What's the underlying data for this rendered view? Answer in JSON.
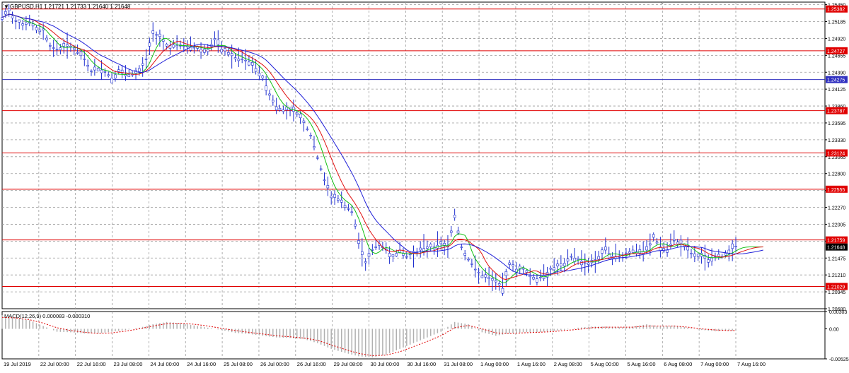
{
  "header": {
    "symbol_label": "GBPUSD,H1",
    "ohlc_label": "1.21721 1.21733 1.21640 1.21648"
  },
  "colors": {
    "candles": "#1f2fcf",
    "ma_fast": "#12c012",
    "ma_mid": "#e01010",
    "ma_slow": "#2020d8",
    "level_red": "#e00000",
    "level_blue": "#3030c0",
    "grid": "#9a9a9a",
    "macd_hist": "#b0b0b0",
    "macd_signal": "#e00000",
    "current_price_bg": "#000000"
  },
  "chart_data": [
    {
      "type": "line",
      "title": "",
      "xlabel": "",
      "ylabel": "",
      "ylim": [
        1.2068,
        1.2549
      ],
      "grid": true,
      "x_tick_labels": [
        "19 Jul 2019",
        "22 Jul 00:00",
        "22 Jul 16:00",
        "23 Jul 08:00",
        "24 Jul 00:00",
        "24 Jul 16:00",
        "25 Jul 08:00",
        "26 Jul 00:00",
        "26 Jul 16:00",
        "29 Jul 08:00",
        "30 Jul 00:00",
        "30 Jul 16:00",
        "31 Jul 08:00",
        "1 Aug 00:00",
        "1 Aug 16:00",
        "2 Aug 08:00",
        "5 Aug 00:00",
        "5 Aug 16:00",
        "6 Aug 08:00",
        "7 Aug 00:00",
        "7 Aug 16:00"
      ],
      "y_tick_labels": [
        "1.25450",
        "1.25185",
        "1.24920",
        "1.24655",
        "1.24390",
        "1.24125",
        "1.23860",
        "1.23595",
        "1.23330",
        "1.23065",
        "1.22800",
        "1.22535",
        "1.22270",
        "1.22005",
        "1.21740",
        "1.21475",
        "1.21210",
        "1.20945",
        "1.20680"
      ],
      "price_levels": [
        {
          "value": 1.25382,
          "label": "1.25382",
          "kind": "red"
        },
        {
          "value": 1.24727,
          "label": "1.24727",
          "kind": "red"
        },
        {
          "value": 1.24275,
          "label": "1.24275",
          "kind": "blue"
        },
        {
          "value": 1.23787,
          "label": "1.23787",
          "kind": "red"
        },
        {
          "value": 1.23124,
          "label": "1.23124",
          "kind": "red"
        },
        {
          "value": 1.22555,
          "label": "1.22555",
          "kind": "red"
        },
        {
          "value": 1.21759,
          "label": "1.21759",
          "kind": "red"
        },
        {
          "value": 1.21029,
          "label": "1.21029",
          "kind": "red"
        }
      ],
      "current_price": {
        "value": 1.21648,
        "label": "1.21648"
      },
      "price_path": [
        [
          0,
          1.2525
        ],
        [
          2,
          1.2535
        ],
        [
          4,
          1.252
        ],
        [
          6,
          1.2515
        ],
        [
          8,
          1.2518
        ],
        [
          10,
          1.2505
        ],
        [
          12,
          1.2505
        ],
        [
          14,
          1.248
        ],
        [
          16,
          1.2475
        ],
        [
          18,
          1.248
        ],
        [
          20,
          1.248
        ],
        [
          22,
          1.247
        ],
        [
          24,
          1.246
        ],
        [
          26,
          1.244
        ],
        [
          28,
          1.2445
        ],
        [
          30,
          1.244
        ],
        [
          32,
          1.243
        ],
        [
          34,
          1.244
        ],
        [
          36,
          1.2435
        ],
        [
          38,
          1.2435
        ],
        [
          40,
          1.244
        ],
        [
          42,
          1.246
        ],
        [
          44,
          1.25
        ],
        [
          46,
          1.2495
        ],
        [
          48,
          1.248
        ],
        [
          50,
          1.2482
        ],
        [
          52,
          1.248
        ],
        [
          54,
          1.248
        ],
        [
          56,
          1.2478
        ],
        [
          58,
          1.2475
        ],
        [
          60,
          1.2475
        ],
        [
          62,
          1.249
        ],
        [
          64,
          1.2475
        ],
        [
          66,
          1.247
        ],
        [
          68,
          1.246
        ],
        [
          70,
          1.246
        ],
        [
          72,
          1.2455
        ],
        [
          74,
          1.2445
        ],
        [
          76,
          1.243
        ],
        [
          78,
          1.2405
        ],
        [
          80,
          1.2385
        ],
        [
          82,
          1.238
        ],
        [
          84,
          1.238
        ],
        [
          86,
          1.2375
        ],
        [
          88,
          1.236
        ],
        [
          90,
          1.234
        ],
        [
          92,
          1.2305
        ],
        [
          94,
          1.227
        ],
        [
          96,
          1.2245
        ],
        [
          98,
          1.224
        ],
        [
          100,
          1.223
        ],
        [
          102,
          1.222
        ],
        [
          104,
          1.2175
        ],
        [
          106,
          1.214
        ],
        [
          108,
          1.216
        ],
        [
          110,
          1.217
        ],
        [
          112,
          1.216
        ],
        [
          114,
          1.215
        ],
        [
          116,
          1.216
        ],
        [
          118,
          1.215
        ],
        [
          120,
          1.2155
        ],
        [
          122,
          1.216
        ],
        [
          124,
          1.2165
        ],
        [
          126,
          1.2165
        ],
        [
          128,
          1.217
        ],
        [
          130,
          1.2165
        ],
        [
          132,
          1.2215
        ],
        [
          134,
          1.2165
        ],
        [
          136,
          1.2145
        ],
        [
          138,
          1.213
        ],
        [
          140,
          1.212
        ],
        [
          142,
          1.2115
        ],
        [
          144,
          1.211
        ],
        [
          146,
          1.21
        ],
        [
          148,
          1.214
        ],
        [
          150,
          1.213
        ],
        [
          152,
          1.213
        ],
        [
          154,
          1.212
        ],
        [
          156,
          1.2115
        ],
        [
          158,
          1.212
        ],
        [
          160,
          1.213
        ],
        [
          162,
          1.2135
        ],
        [
          164,
          1.2135
        ],
        [
          166,
          1.215
        ],
        [
          168,
          1.2145
        ],
        [
          170,
          1.214
        ],
        [
          172,
          1.214
        ],
        [
          174,
          1.215
        ],
        [
          176,
          1.216
        ],
        [
          178,
          1.215
        ],
        [
          180,
          1.215
        ],
        [
          182,
          1.2155
        ],
        [
          184,
          1.216
        ],
        [
          186,
          1.2155
        ],
        [
          188,
          1.216
        ],
        [
          190,
          1.218
        ],
        [
          192,
          1.2165
        ],
        [
          194,
          1.216
        ],
        [
          196,
          1.2175
        ],
        [
          198,
          1.217
        ],
        [
          200,
          1.216
        ],
        [
          202,
          1.215
        ],
        [
          204,
          1.215
        ],
        [
          206,
          1.2145
        ],
        [
          208,
          1.215
        ],
        [
          210,
          1.215
        ],
        [
          212,
          1.216
        ],
        [
          214,
          1.2165
        ]
      ]
    },
    {
      "type": "area",
      "title": "",
      "indicator_label": "MACD(12,26,9) 0.000083 -0.000310",
      "ylim": [
        -0.00525,
        0.00303
      ],
      "y_tick_labels": [
        "0.00303",
        "0.00",
        "-0.00525"
      ],
      "histogram": [
        [
          0,
          0.0024
        ],
        [
          4,
          0.002
        ],
        [
          8,
          0.0015
        ],
        [
          12,
          0.0005
        ],
        [
          16,
          -0.0005
        ],
        [
          20,
          -0.0006
        ],
        [
          24,
          -0.0008
        ],
        [
          28,
          -0.0008
        ],
        [
          32,
          -0.0005
        ],
        [
          36,
          -0.0002
        ],
        [
          40,
          0.0002
        ],
        [
          44,
          0.0008
        ],
        [
          48,
          0.0012
        ],
        [
          52,
          0.001
        ],
        [
          56,
          0.0006
        ],
        [
          60,
          0.0002
        ],
        [
          64,
          -0.0002
        ],
        [
          68,
          -0.0007
        ],
        [
          72,
          -0.0009
        ],
        [
          76,
          -0.0012
        ],
        [
          80,
          -0.0015
        ],
        [
          84,
          -0.0016
        ],
        [
          88,
          -0.0018
        ],
        [
          92,
          -0.0025
        ],
        [
          96,
          -0.0035
        ],
        [
          100,
          -0.0042
        ],
        [
          104,
          -0.0048
        ],
        [
          108,
          -0.005
        ],
        [
          112,
          -0.0045
        ],
        [
          116,
          -0.0035
        ],
        [
          120,
          -0.0025
        ],
        [
          124,
          -0.0015
        ],
        [
          128,
          -0.0005
        ],
        [
          132,
          0.0012
        ],
        [
          136,
          0.0008
        ],
        [
          140,
          -0.0006
        ],
        [
          144,
          -0.0012
        ],
        [
          148,
          -0.0008
        ],
        [
          152,
          -0.0006
        ],
        [
          156,
          -0.0006
        ],
        [
          160,
          -0.0004
        ],
        [
          164,
          -0.0002
        ],
        [
          168,
          0.0002
        ],
        [
          172,
          0.0004
        ],
        [
          176,
          0.0004
        ],
        [
          180,
          0.0003
        ],
        [
          184,
          0.0004
        ],
        [
          188,
          0.0008
        ],
        [
          192,
          0.0004
        ],
        [
          196,
          0.0006
        ],
        [
          200,
          0.0002
        ],
        [
          204,
          -0.0002
        ],
        [
          208,
          -0.0004
        ],
        [
          212,
          -0.0003
        ],
        [
          214,
          -0.0003
        ]
      ],
      "signal": [
        [
          0,
          0.002
        ],
        [
          4,
          0.0019
        ],
        [
          8,
          0.0016
        ],
        [
          12,
          0.001
        ],
        [
          16,
          0.0002
        ],
        [
          20,
          -0.0003
        ],
        [
          24,
          -0.0006
        ],
        [
          28,
          -0.0008
        ],
        [
          32,
          -0.0007
        ],
        [
          36,
          -0.0004
        ],
        [
          40,
          0.0
        ],
        [
          44,
          0.0005
        ],
        [
          48,
          0.0009
        ],
        [
          52,
          0.001
        ],
        [
          56,
          0.0008
        ],
        [
          60,
          0.0005
        ],
        [
          64,
          0.0001
        ],
        [
          68,
          -0.0003
        ],
        [
          72,
          -0.0006
        ],
        [
          76,
          -0.0009
        ],
        [
          80,
          -0.0012
        ],
        [
          84,
          -0.0014
        ],
        [
          88,
          -0.0016
        ],
        [
          92,
          -0.002
        ],
        [
          96,
          -0.0028
        ],
        [
          100,
          -0.0036
        ],
        [
          104,
          -0.0043
        ],
        [
          108,
          -0.0047
        ],
        [
          112,
          -0.0046
        ],
        [
          116,
          -0.004
        ],
        [
          120,
          -0.0031
        ],
        [
          124,
          -0.0022
        ],
        [
          128,
          -0.0012
        ],
        [
          132,
          0.0002
        ],
        [
          136,
          0.0006
        ],
        [
          140,
          0.0
        ],
        [
          144,
          -0.0007
        ],
        [
          148,
          -0.0008
        ],
        [
          152,
          -0.0007
        ],
        [
          156,
          -0.0006
        ],
        [
          160,
          -0.0005
        ],
        [
          164,
          -0.0003
        ],
        [
          168,
          -0.0001
        ],
        [
          172,
          0.0002
        ],
        [
          176,
          0.0003
        ],
        [
          180,
          0.0003
        ],
        [
          184,
          0.0003
        ],
        [
          188,
          0.0005
        ],
        [
          192,
          0.0005
        ],
        [
          196,
          0.0005
        ],
        [
          200,
          0.0003
        ],
        [
          204,
          0.0
        ],
        [
          208,
          -0.0002
        ],
        [
          212,
          -0.0003
        ],
        [
          214,
          -0.0003
        ]
      ]
    }
  ]
}
